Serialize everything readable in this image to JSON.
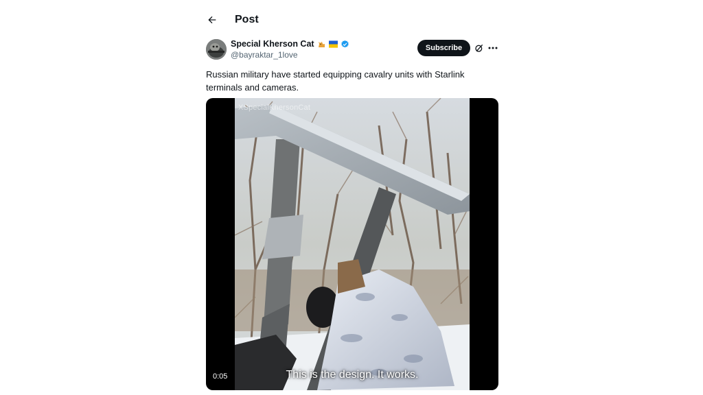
{
  "header": {
    "back_icon": "arrow-left-icon",
    "title": "Post"
  },
  "author": {
    "display_name": "Special Kherson Cat",
    "handle": "@bayraktar_1love",
    "name_icons": [
      "cat-emoji-icon",
      "ukraine-flag-icon",
      "verified-badge-icon"
    ],
    "verified_color": "#1d9bf0"
  },
  "actions": {
    "subscribe_label": "Subscribe",
    "grok_icon": "grok-icon",
    "more_icon": "more-horizontal-icon"
  },
  "post": {
    "text": "Russian military have started equipping cavalry units with Starlink terminals and cameras."
  },
  "media": {
    "watermark": "XSpecialKhersonCat",
    "caption": "This is the design. It works.",
    "timestamp": "0:05"
  }
}
